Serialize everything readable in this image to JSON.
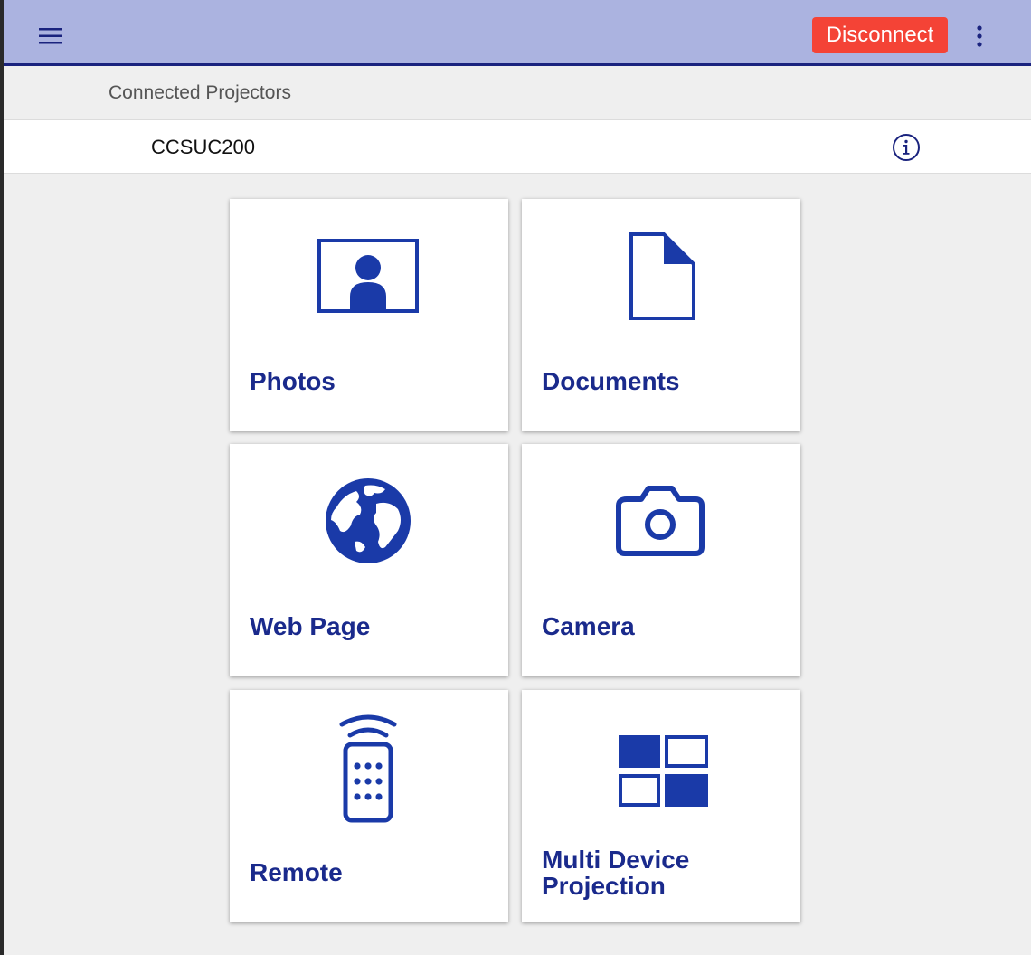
{
  "appbar": {
    "menu_icon": "menu-icon",
    "disconnect_label": "Disconnect",
    "more_icon": "more-vertical-icon",
    "accent": "#abb3e0",
    "disconnect_color": "#f44336"
  },
  "projectors": {
    "header": "Connected Projectors",
    "items": [
      {
        "name": "CCSUC200",
        "icon": "info-icon"
      }
    ]
  },
  "tiles": [
    {
      "label": "Photos",
      "icon": "photo-icon"
    },
    {
      "label": "Documents",
      "icon": "document-icon"
    },
    {
      "label": "Web Page",
      "icon": "globe-icon"
    },
    {
      "label": "Camera",
      "icon": "camera-icon"
    },
    {
      "label": "Remote",
      "icon": "remote-icon"
    },
    {
      "label": "Multi Device Projection",
      "icon": "multi-device-icon"
    }
  ],
  "colors": {
    "icon_blue": "#1a3aa8",
    "label_blue": "#1a2a8c"
  }
}
